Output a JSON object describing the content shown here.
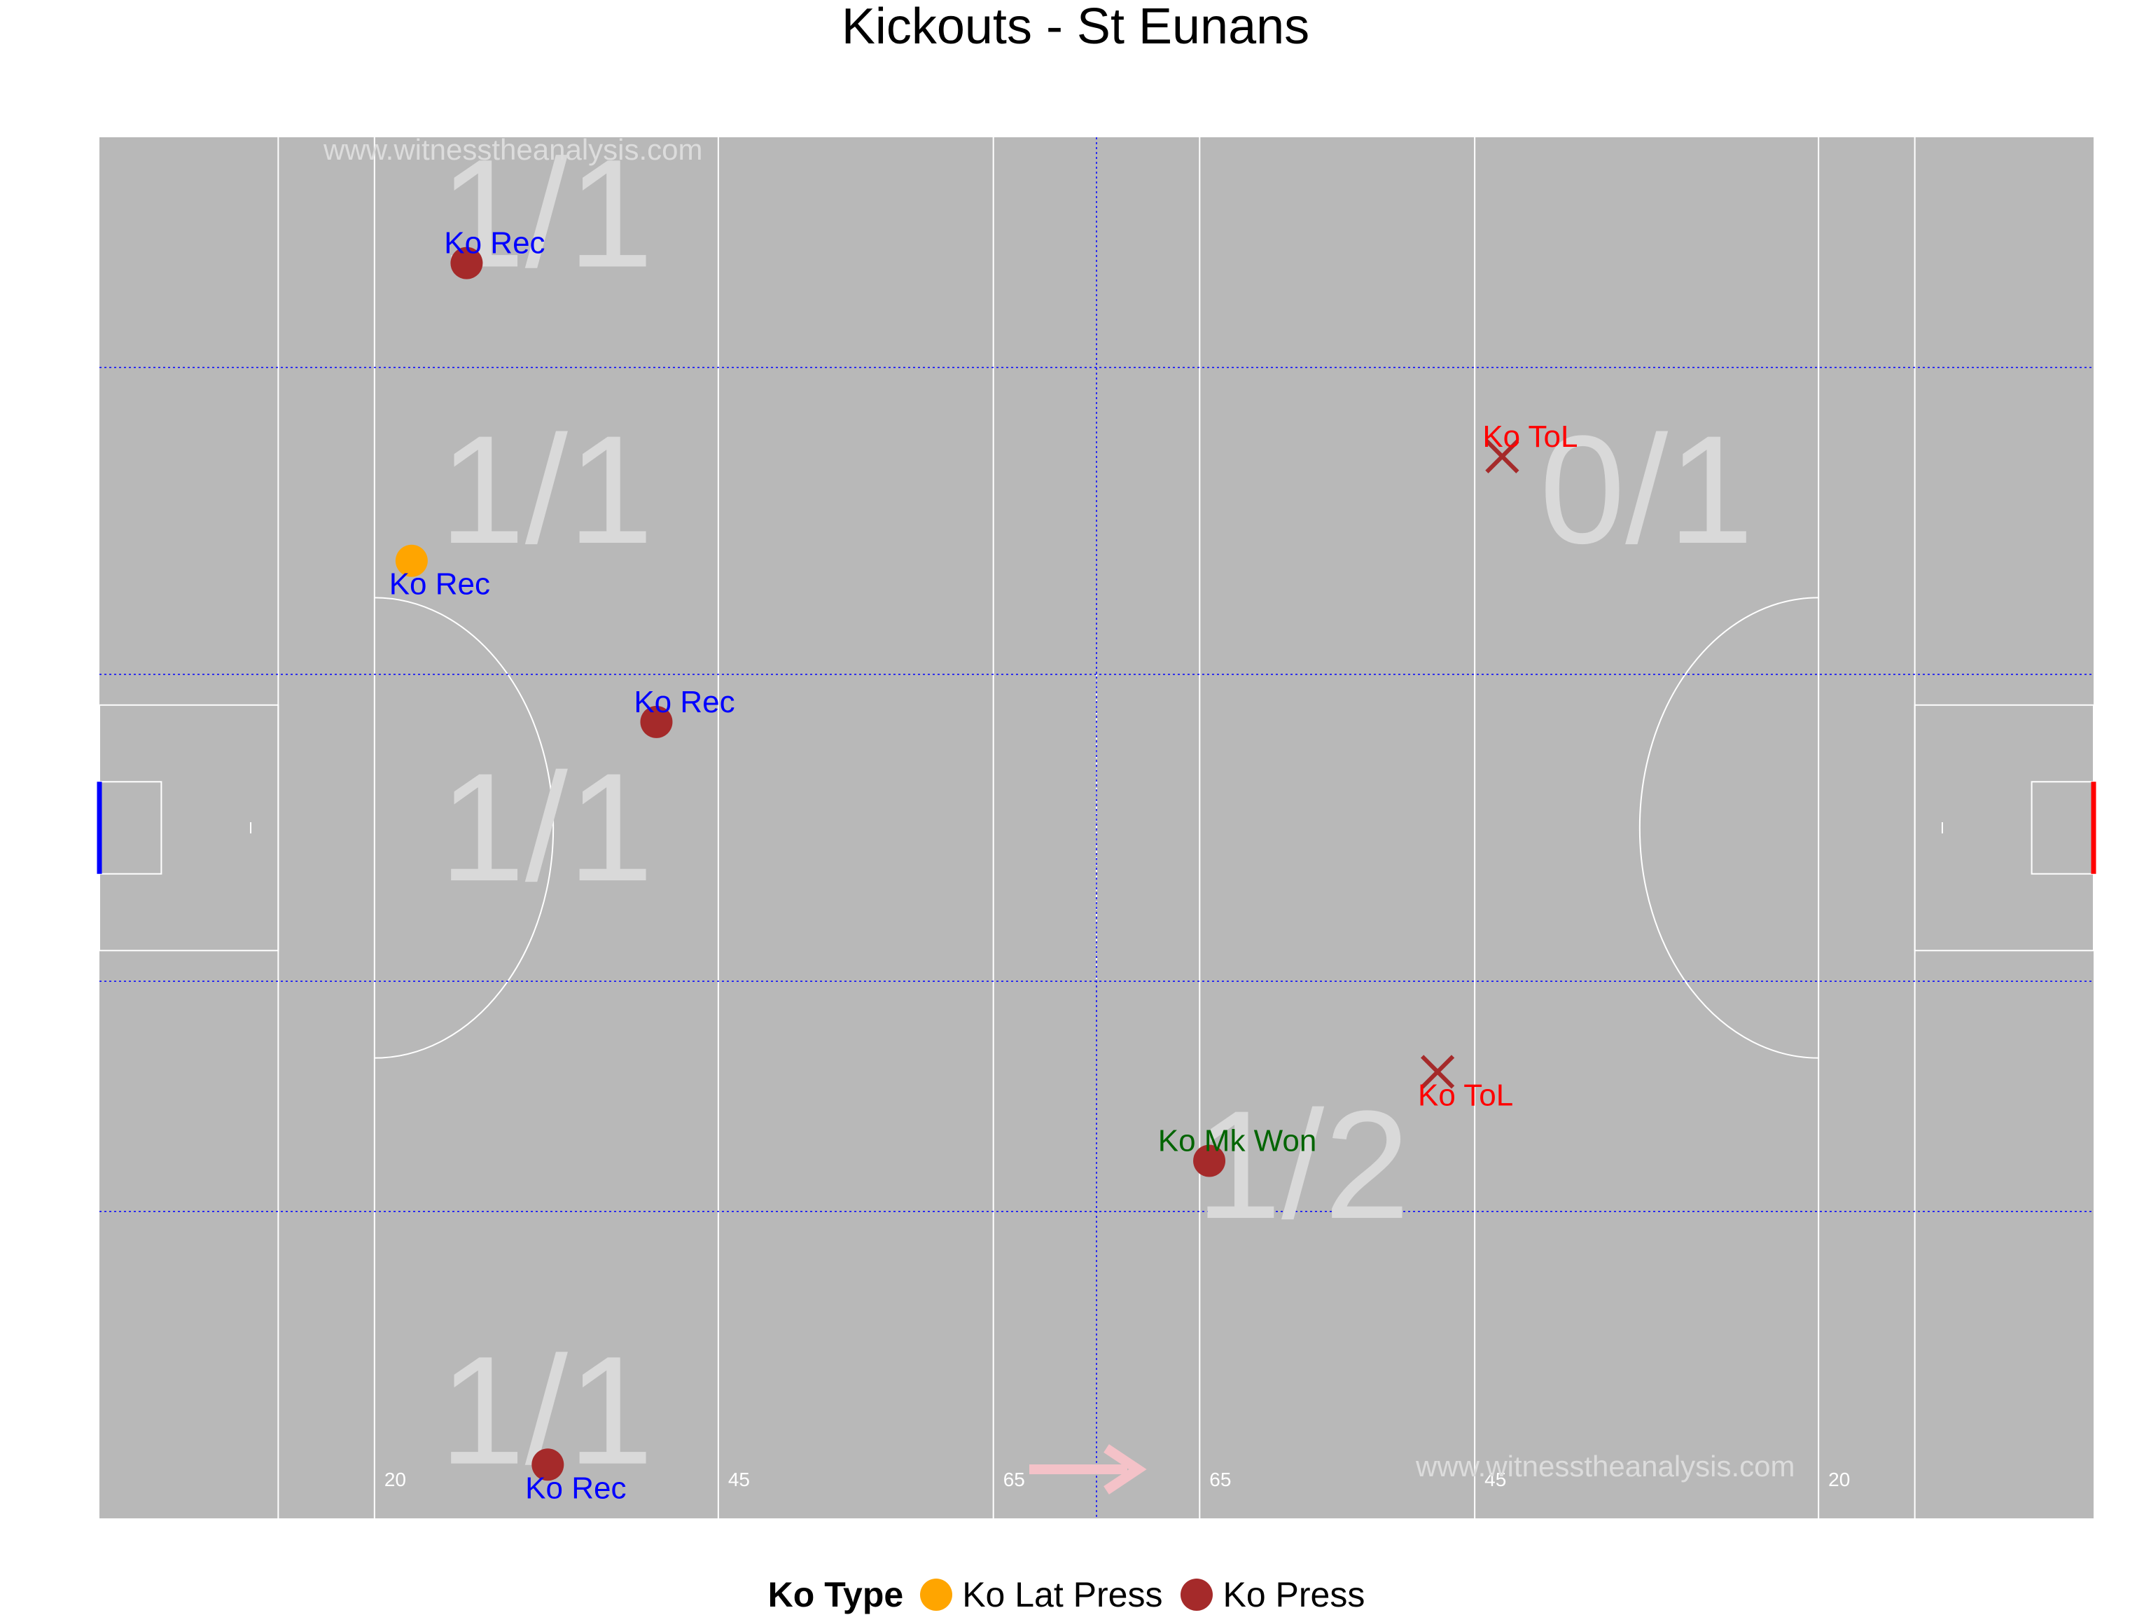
{
  "chart_data": {
    "type": "scatter",
    "title": "Kickouts - St Eunans",
    "watermark": "www.witnesstheanalysis.com",
    "xlim": [
      0,
      145
    ],
    "ylim": [
      0,
      90
    ],
    "distance_labels": [
      {
        "x": 20,
        "label": "20"
      },
      {
        "x": 45,
        "label": "45"
      },
      {
        "x": 65,
        "label": "65"
      },
      {
        "x": 80,
        "label": "65"
      },
      {
        "x": 100,
        "label": "45"
      },
      {
        "x": 125,
        "label": "20"
      }
    ],
    "zones": [
      {
        "x": 32.5,
        "y": 85,
        "label": "1/1"
      },
      {
        "x": 32.5,
        "y": 67,
        "label": "1/1"
      },
      {
        "x": 32.5,
        "y": 45,
        "label": "1/1"
      },
      {
        "x": 32.5,
        "y": 7,
        "label": "1/1"
      },
      {
        "x": 112.5,
        "y": 67,
        "label": "0/1"
      },
      {
        "x": 87.5,
        "y": 23,
        "label": "1/2"
      }
    ],
    "points": [
      {
        "x": 26.7,
        "y": 81.8,
        "type": "Ko Press",
        "marker": "circle",
        "label": "Ko Rec",
        "label_pos": "above",
        "label_color": "#0000ff"
      },
      {
        "x": 22.7,
        "y": 62.4,
        "type": "Ko Lat Press",
        "marker": "circle",
        "label": "Ko Rec",
        "label_pos": "below",
        "label_color": "#0000ff"
      },
      {
        "x": 40.5,
        "y": 51.9,
        "type": "Ko Press",
        "marker": "circle",
        "label": "Ko Rec",
        "label_pos": "above",
        "label_color": "#0000ff"
      },
      {
        "x": 32.6,
        "y": 3.5,
        "type": "Ko Press",
        "marker": "circle",
        "label": "Ko Rec",
        "label_pos": "below",
        "label_color": "#0000ff"
      },
      {
        "x": 80.7,
        "y": 23.3,
        "type": "Ko Press",
        "marker": "circle",
        "label": "Ko Mk Won",
        "label_pos": "above",
        "label_color": "#006400"
      },
      {
        "x": 102.0,
        "y": 69.2,
        "type": "Ko Press",
        "marker": "cross",
        "label": "Ko ToL",
        "label_pos": "above",
        "label_color": "#ff0000"
      },
      {
        "x": 97.3,
        "y": 29.1,
        "type": "Ko Press",
        "marker": "cross",
        "label": "Ko ToL",
        "label_pos": "below",
        "label_color": "#ff0000"
      }
    ],
    "legend": {
      "title": "Ko Type",
      "items": [
        {
          "label": "Ko Lat Press",
          "color": "#ffa500"
        },
        {
          "label": "Ko Press",
          "color": "#a52a2a"
        }
      ],
      "position": "bottom"
    },
    "colors": {
      "pitch": "#b8b8b8",
      "lines": "#ffffff",
      "grid": "#0000ff",
      "zone_text": "#d9d9d9",
      "marker": "#a52a2a",
      "lat_press": "#ffa500",
      "left_goal": "#0000ff",
      "right_goal": "#ff0000",
      "direction_arrow": "#f4c2c8"
    }
  }
}
